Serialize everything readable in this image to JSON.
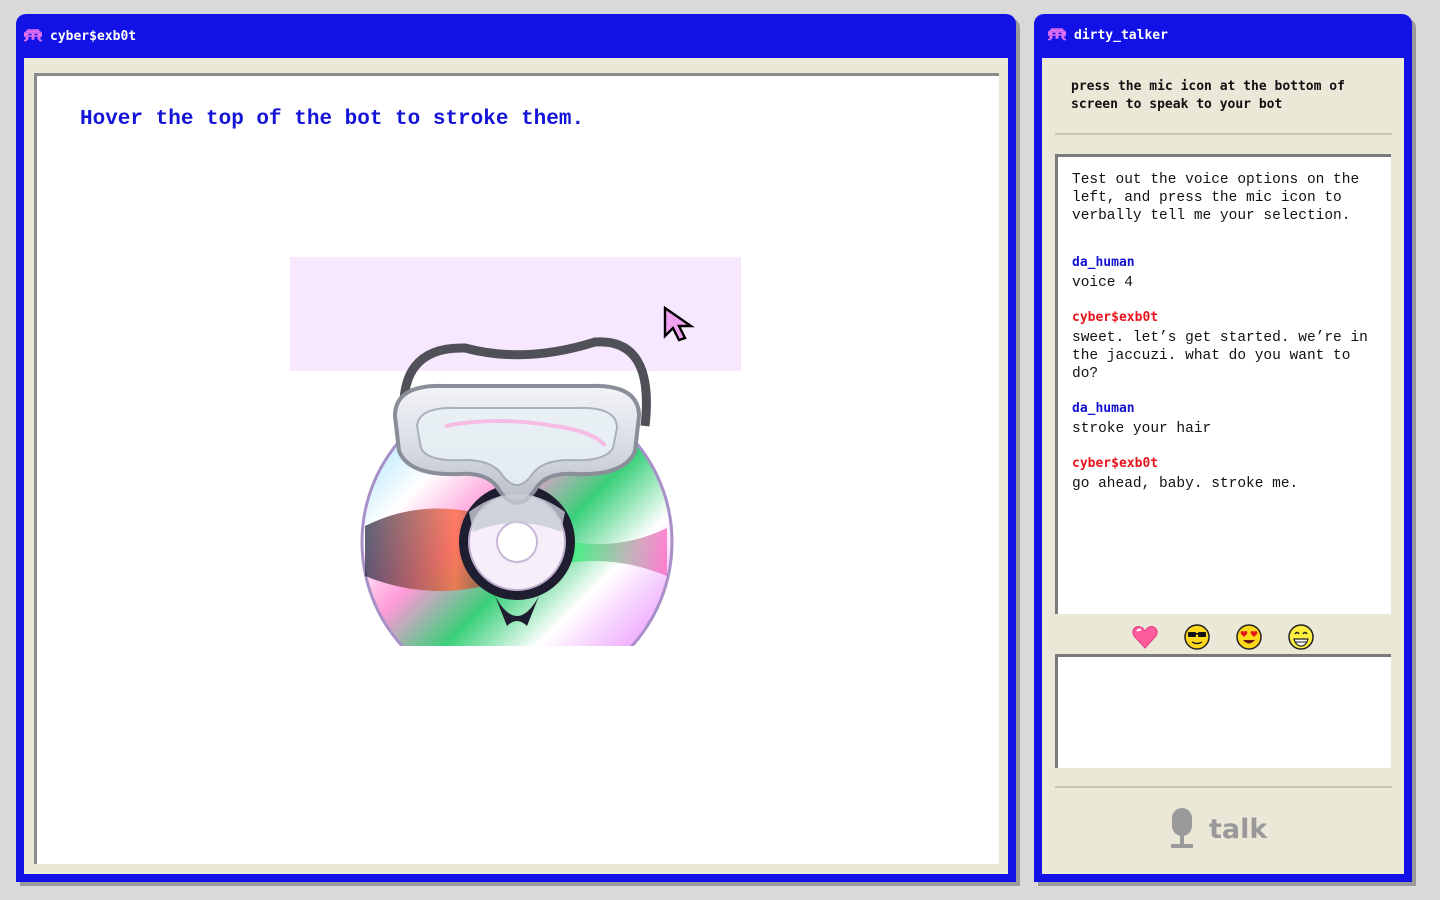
{
  "main_window": {
    "title": "cyber$exb0t",
    "instruction": "Hover the top of the bot to stroke them."
  },
  "chat_window": {
    "title": "dirty_talker",
    "hint": "press the mic icon at the bottom of screen to speak to your bot",
    "messages": [
      {
        "speaker": "",
        "text": "Test out the voice options on the left, and press the mic icon to verbally tell me your selection."
      },
      {
        "speaker": "da_human",
        "text": "voice 4"
      },
      {
        "speaker": "cyber$exb0t",
        "text": "sweet. let’s get started. we’re in the jaccuzi. what do you want to do?"
      },
      {
        "speaker": "da_human",
        "text": "stroke your hair"
      },
      {
        "speaker": "cyber$exb0t",
        "text": "go ahead, baby. stroke me."
      }
    ],
    "emojis": [
      "heart-icon",
      "cool-face-icon",
      "heart-eyes-face-icon",
      "grin-face-icon"
    ],
    "input_value": "",
    "talk_label": "talk"
  },
  "colors": {
    "window_blue": "#1212e6",
    "human_name": "#1212d0",
    "bot_name": "#e8141c",
    "hover_zone": "#f8e8ff"
  }
}
